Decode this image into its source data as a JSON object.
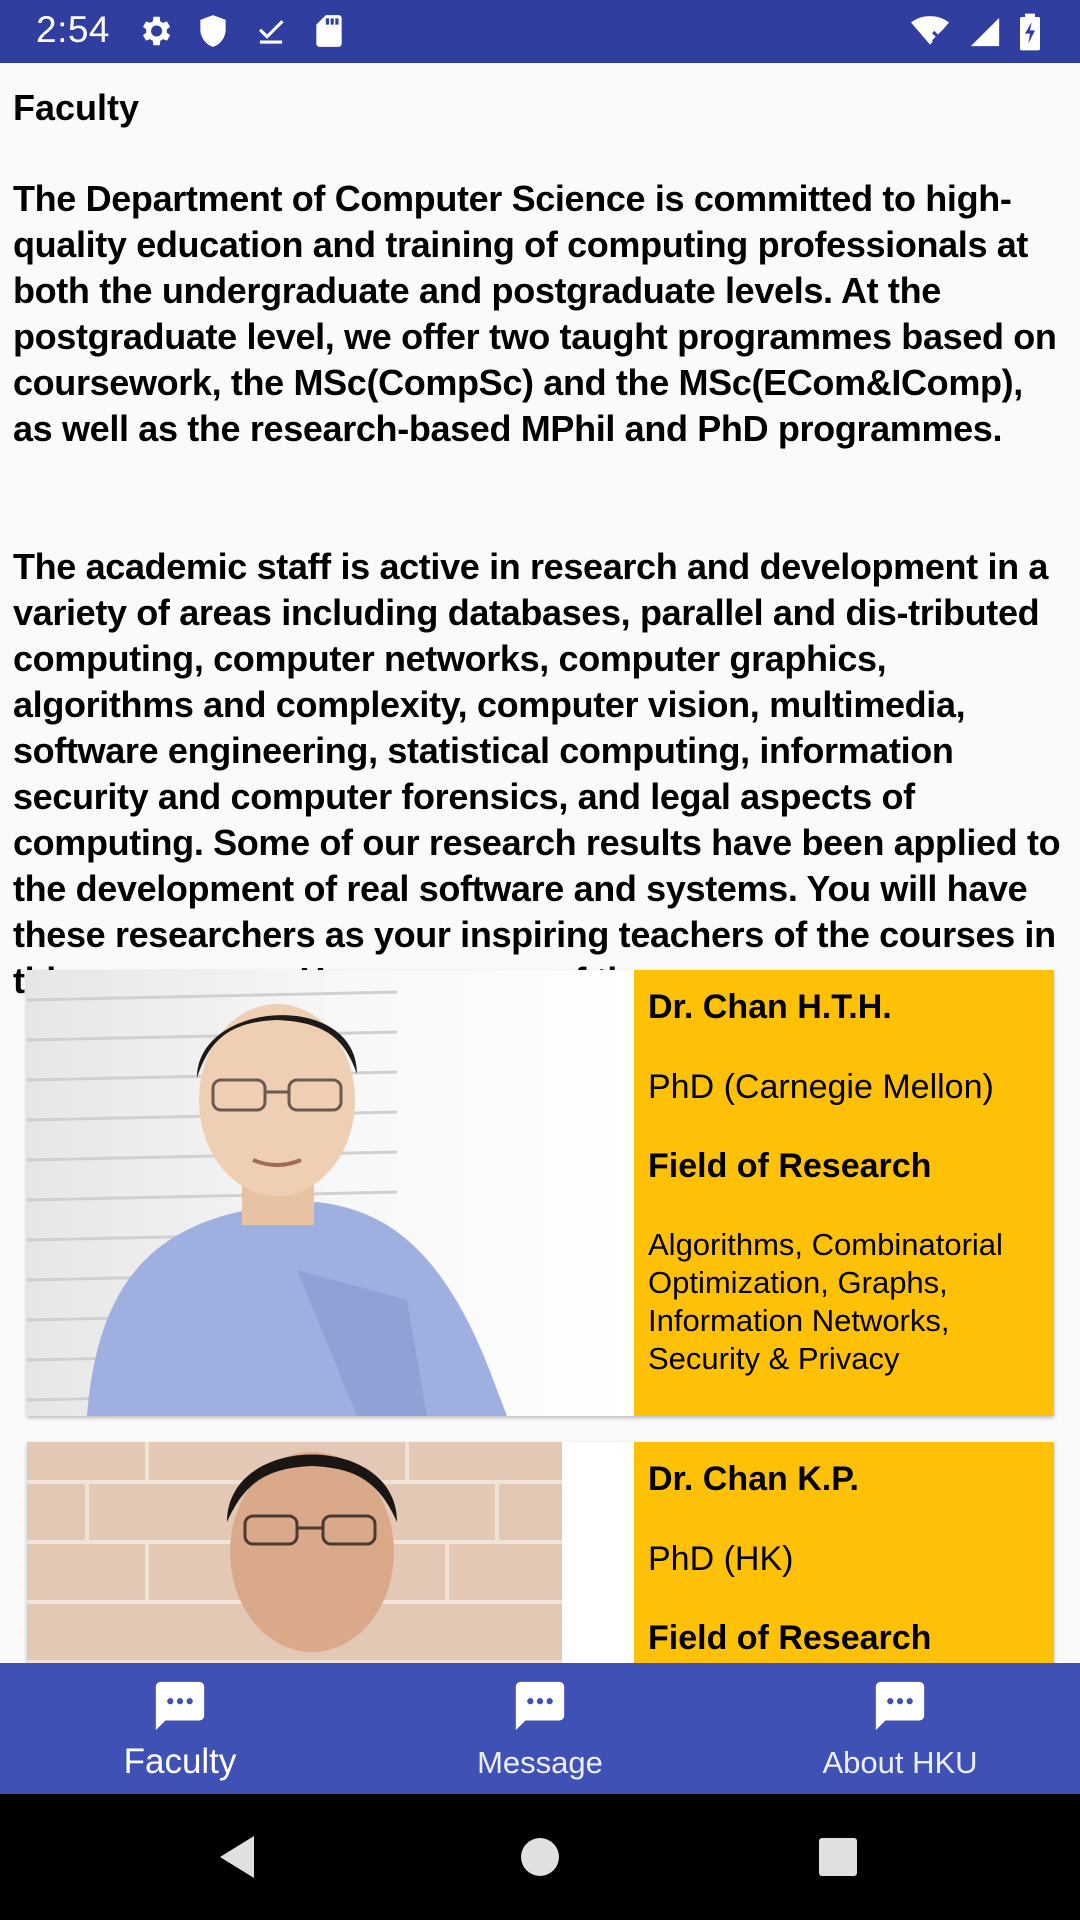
{
  "status_bar": {
    "time": "2:54",
    "left_icons": [
      "gear-icon",
      "shield-icon",
      "download-done-icon",
      "sd-card-icon"
    ],
    "right_icons": [
      "wifi-off-icon",
      "cell-signal-icon",
      "battery-charging-icon"
    ]
  },
  "page": {
    "title": "Faculty",
    "paragraph_1": "The Department of Computer Science is committed to high-quality education and training of computing professionals at both the undergraduate and postgraduate levels. At the postgraduate level, we offer two taught programmes based on coursework, the MSc(CompSc) and the MSc(ECom&IComp), as well as the research-based MPhil and PhD programmes.",
    "paragraph_2": "The academic staff is active in research and development in a variety of areas including databases, parallel and dis-tributed computing, computer networks, computer graphics, algorithms and complexity, computer vision, multimedia, software engineering, statistical computing, information security and computer forensics, and legal aspects of computing. Some of our research results have been applied to the development of real software and systems. You will have these researchers as your inspiring teachers of the courses in this programme. Here are some of them"
  },
  "faculty": [
    {
      "name": "Dr. Chan H.T.H.",
      "degree": "PhD (Carnegie Mellon)",
      "field_heading": "Field of Research",
      "field": "Algorithms, Combinatorial Optimization, Graphs, Information Networks, Security & Privacy"
    },
    {
      "name": "Dr. Chan K.P.",
      "degree": "PhD (HK)",
      "field_heading": "Field of Research",
      "field": ""
    }
  ],
  "bottom_nav": {
    "items": [
      {
        "label": "Faculty",
        "icon": "chat-icon",
        "active": true
      },
      {
        "label": "Message",
        "icon": "chat-icon",
        "active": false
      },
      {
        "label": "About HKU",
        "icon": "chat-icon",
        "active": false
      }
    ]
  },
  "colors": {
    "status_bar": "#303f9f",
    "primary": "#3f51b5",
    "card_info": "#ffc107"
  }
}
